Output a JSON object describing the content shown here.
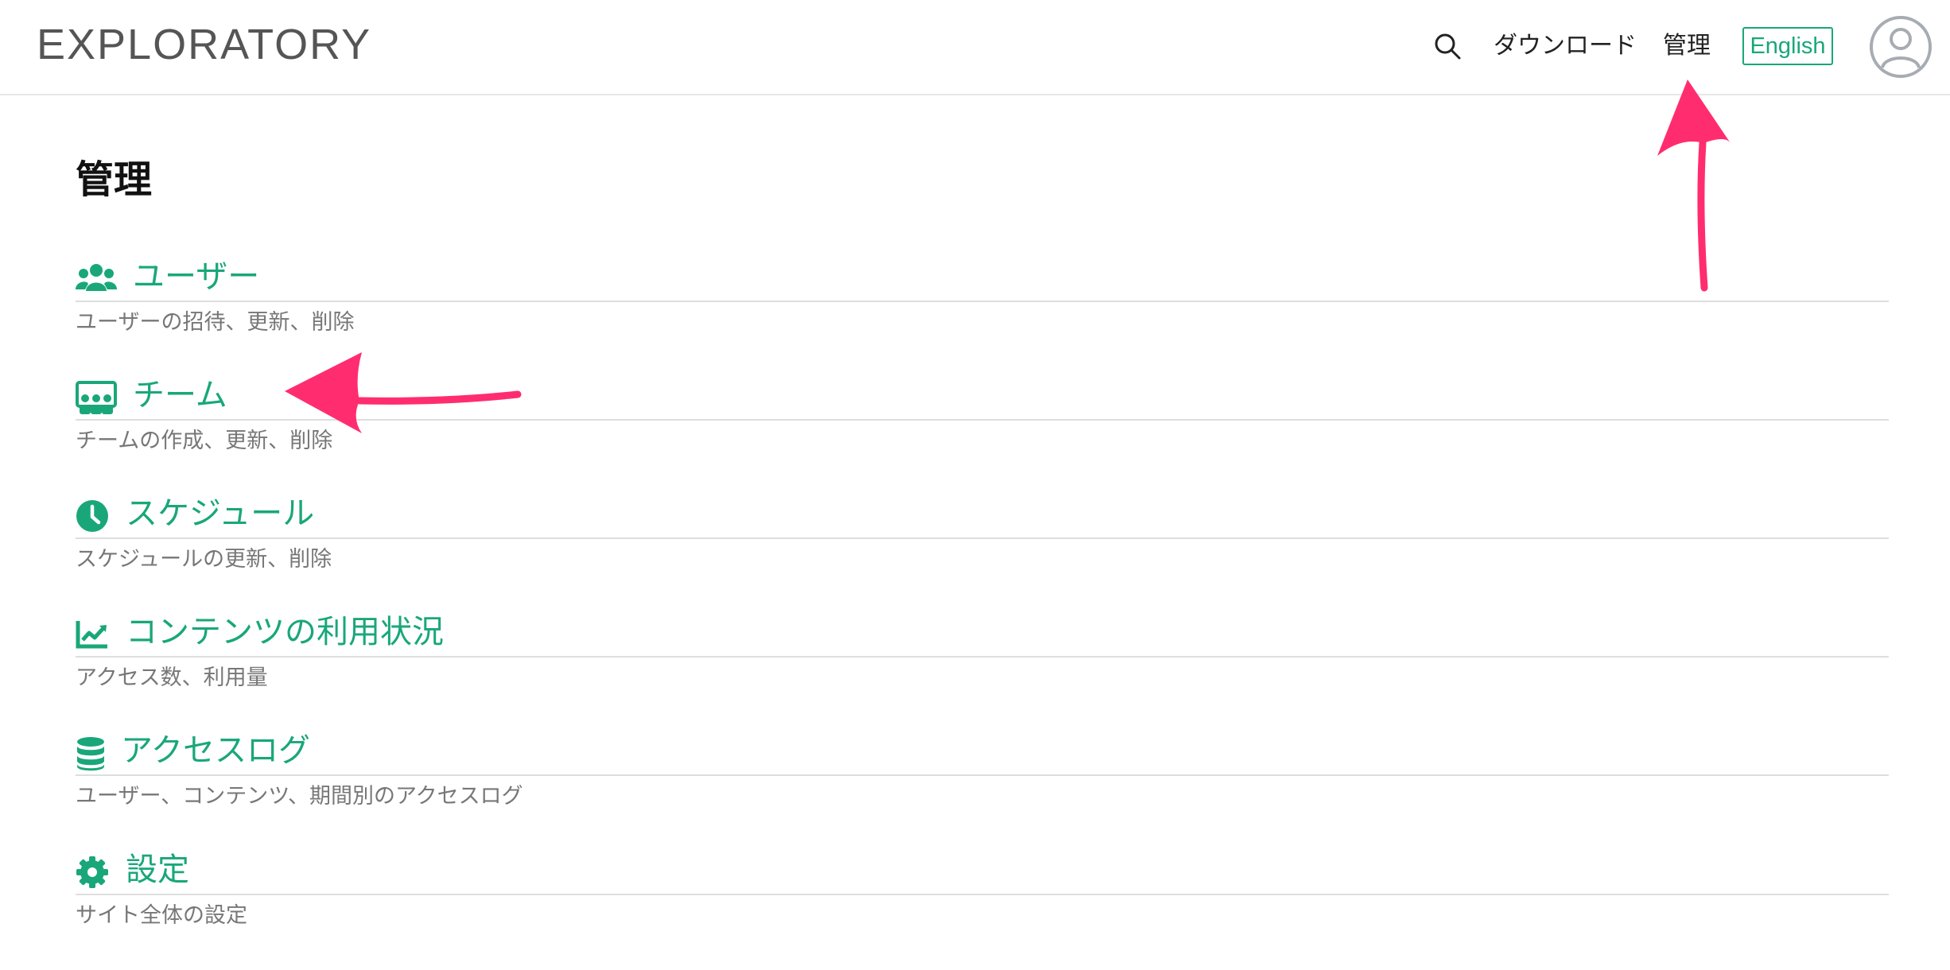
{
  "header": {
    "logo": "EXPLORATORY",
    "search_icon": "search-icon",
    "download_label": "ダウンロード",
    "admin_label": "管理",
    "language_button": "English",
    "avatar_icon": "user-avatar-icon"
  },
  "main": {
    "title": "管理",
    "items": [
      {
        "icon": "users-icon",
        "title": "ユーザー",
        "description": "ユーザーの招待、更新、削除"
      },
      {
        "icon": "team-icon",
        "title": "チーム",
        "description": "チームの作成、更新、削除"
      },
      {
        "icon": "clock-icon",
        "title": "スケジュール",
        "description": "スケジュールの更新、削除"
      },
      {
        "icon": "chart-line-icon",
        "title": "コンテンツの利用状況",
        "description": "アクセス数、利用量"
      },
      {
        "icon": "database-icon",
        "title": "アクセスログ",
        "description": "ユーザー、コンテンツ、期間別のアクセスログ"
      },
      {
        "icon": "gear-icon",
        "title": "設定",
        "description": "サイト全体の設定"
      }
    ]
  },
  "colors": {
    "accent": "#19a77a",
    "annotation_arrow": "#ff2d6f",
    "description_text": "#777777"
  }
}
